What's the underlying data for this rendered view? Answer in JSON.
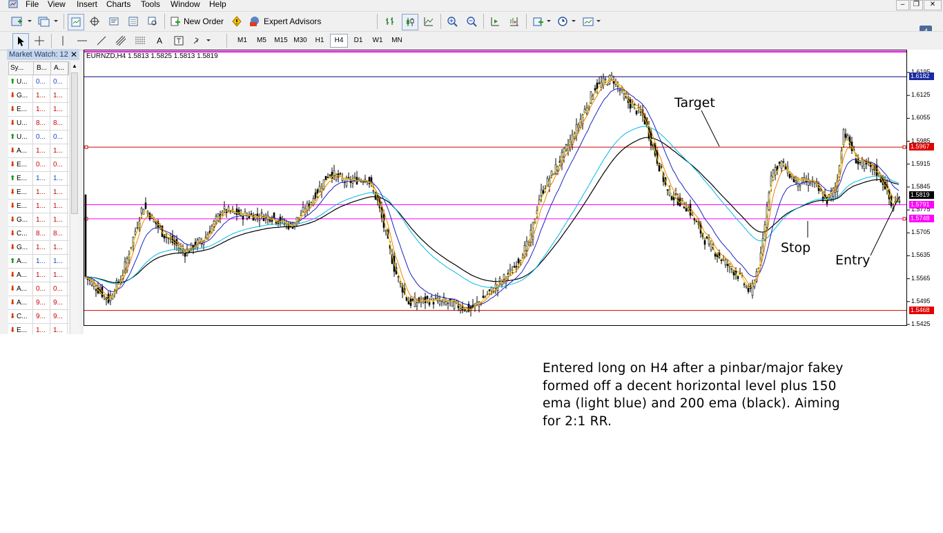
{
  "menu": {
    "items": [
      "File",
      "View",
      "Insert",
      "Charts",
      "Tools",
      "Window",
      "Help"
    ]
  },
  "toolbar": {
    "new_order_label": "New Order",
    "expert_advisors_label": "Expert Advisors",
    "timeframes": [
      "M1",
      "M5",
      "M15",
      "M30",
      "H1",
      "H4",
      "D1",
      "W1",
      "MN"
    ],
    "active_timeframe": "H4",
    "notification_count": "4"
  },
  "market_watch": {
    "title": "Market Watch: 12",
    "columns": [
      "Sy...",
      "B...",
      "A..."
    ],
    "rows": [
      {
        "dir": "up",
        "symbol": "U...",
        "bid": "0...",
        "ask": "0..."
      },
      {
        "dir": "down",
        "symbol": "G...",
        "bid": "1...",
        "ask": "1..."
      },
      {
        "dir": "down",
        "symbol": "E...",
        "bid": "1...",
        "ask": "1..."
      },
      {
        "dir": "down",
        "symbol": "U...",
        "bid": "8...",
        "ask": "8..."
      },
      {
        "dir": "up",
        "symbol": "U...",
        "bid": "0...",
        "ask": "0..."
      },
      {
        "dir": "down",
        "symbol": "A...",
        "bid": "1...",
        "ask": "1..."
      },
      {
        "dir": "down",
        "symbol": "E...",
        "bid": "0...",
        "ask": "0..."
      },
      {
        "dir": "up",
        "symbol": "E...",
        "bid": "1...",
        "ask": "1..."
      },
      {
        "dir": "down",
        "symbol": "E...",
        "bid": "1...",
        "ask": "1..."
      },
      {
        "dir": "down",
        "symbol": "E...",
        "bid": "1...",
        "ask": "1..."
      },
      {
        "dir": "down",
        "symbol": "G...",
        "bid": "1...",
        "ask": "1..."
      },
      {
        "dir": "down",
        "symbol": "C...",
        "bid": "8...",
        "ask": "8..."
      },
      {
        "dir": "down",
        "symbol": "G...",
        "bid": "1...",
        "ask": "1..."
      },
      {
        "dir": "up",
        "symbol": "A...",
        "bid": "1...",
        "ask": "1..."
      },
      {
        "dir": "down",
        "symbol": "A...",
        "bid": "1...",
        "ask": "1..."
      },
      {
        "dir": "down",
        "symbol": "A...",
        "bid": "0...",
        "ask": "0..."
      },
      {
        "dir": "down",
        "symbol": "A...",
        "bid": "9...",
        "ask": "9..."
      },
      {
        "dir": "down",
        "symbol": "C...",
        "bid": "9...",
        "ask": "9..."
      },
      {
        "dir": "down",
        "symbol": "E...",
        "bid": "1...",
        "ask": "1..."
      }
    ]
  },
  "chart": {
    "header": "EURNZD,H4  1.5813 1.5825 1.5813 1.5819",
    "axis_ticks": [
      "1.6195",
      "1.6125",
      "1.6055",
      "1.5985",
      "1.5915",
      "1.5845",
      "1.5775",
      "1.5705",
      "1.5635",
      "1.5565",
      "1.5495",
      "1.5425"
    ],
    "levels": [
      {
        "price": 1.6182,
        "label": "1.6182",
        "color": "#1a2aa0",
        "line": "#000080"
      },
      {
        "price": 1.5967,
        "label": "1.5967",
        "color": "#e00000",
        "line": "#d00000"
      },
      {
        "price": 1.5819,
        "label": "1.5819",
        "color": "#000000",
        "line": null
      },
      {
        "price": 1.5791,
        "label": "1.5791",
        "color": "#ff00ff",
        "line": "#ff00ff"
      },
      {
        "price": 1.5748,
        "label": "1.5748",
        "color": "#ff00ff",
        "line": "#ff00ff"
      },
      {
        "price": 1.5468,
        "label": "1.5468",
        "color": "#e00000",
        "line": "#d00000"
      }
    ],
    "annotations": {
      "target": "Target",
      "stop": "Stop",
      "entry": "Entry"
    },
    "colors": {
      "ema_150": "#00b8e8",
      "ema_200": "#000000",
      "ma_fast": "#e8c800",
      "ma_mid": "#f08000",
      "ma_slow": "#1a20c0"
    }
  },
  "commentary": {
    "text": "Entered long on H4 after a pinbar/major fakey formed off a decent horizontal level plus 150 ema (light blue) and 200 ema (black). Aiming for 2:1 RR."
  }
}
